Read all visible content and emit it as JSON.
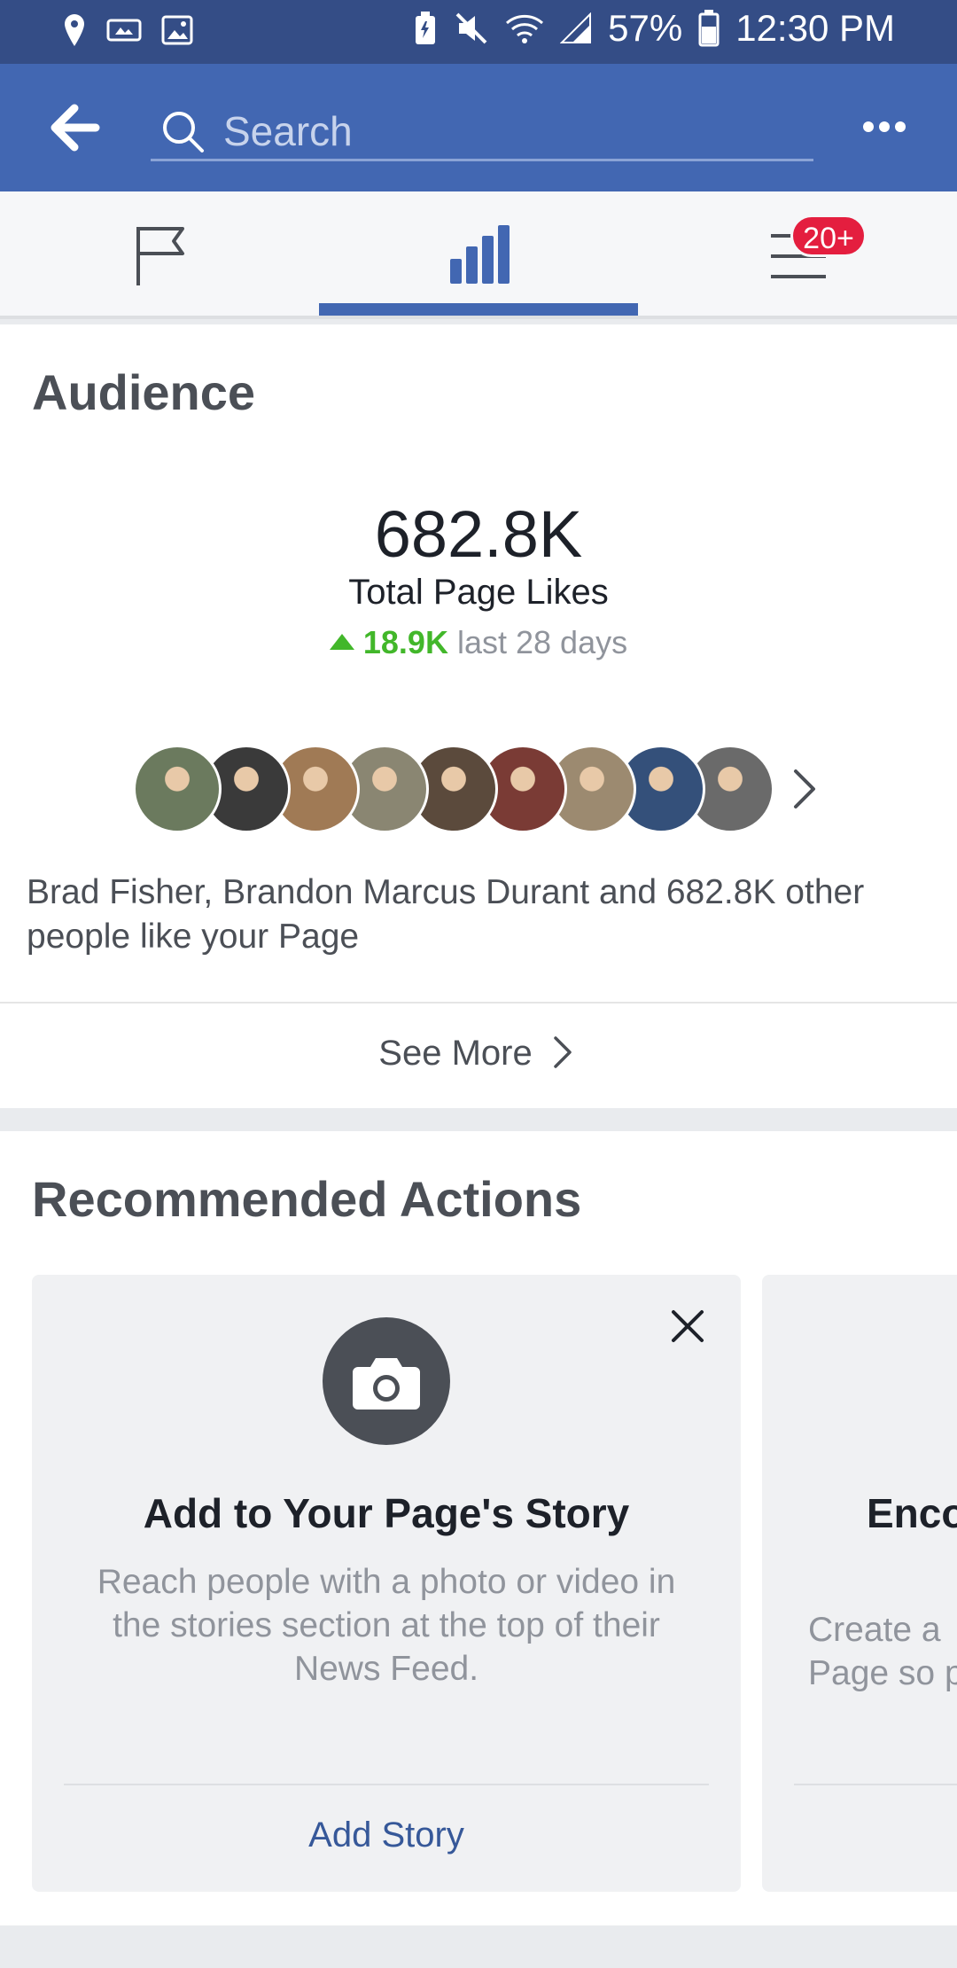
{
  "status_bar": {
    "battery_pct": "57%",
    "time": "12:30 PM",
    "icons": [
      "location-icon",
      "sports-icon",
      "image-icon",
      "battery-saver-icon",
      "mute-icon",
      "wifi-icon",
      "signal-icon",
      "battery-icon"
    ]
  },
  "nav": {
    "search_placeholder": "Search"
  },
  "tabs": {
    "items": [
      "flag-icon",
      "insights-icon",
      "menu-icon"
    ],
    "active_index": 1,
    "notification_badge": "20+"
  },
  "audience": {
    "title": "Audience",
    "total_likes": "682.8K",
    "total_likes_label": "Total Page Likes",
    "growth_value": "18.9K",
    "growth_period": "last 28 days",
    "likers_text": "Brad Fisher, Brandon Marcus Durant and 682.8K other people like your Page",
    "see_more": "See More",
    "avatar_colors": [
      "#6b7a5e",
      "#3a3a3a",
      "#a07a55",
      "#8a8672",
      "#5b4a3c",
      "#7a3b35",
      "#9c8a70",
      "#34507a",
      "#6a6a6a"
    ]
  },
  "recommended": {
    "title": "Recommended Actions",
    "cards": [
      {
        "title": "Add to Your Page's Story",
        "description": "Reach people with a photo or video in the stories section at the top of their News Feed.",
        "button": "Add Story"
      },
      {
        "title": "Enco",
        "description": "Create a\nPage so p"
      }
    ]
  },
  "colors": {
    "brand": "#4267b2",
    "status_bar": "#344d86",
    "growth_green": "#42b72a",
    "badge_red": "#e41e3f"
  }
}
